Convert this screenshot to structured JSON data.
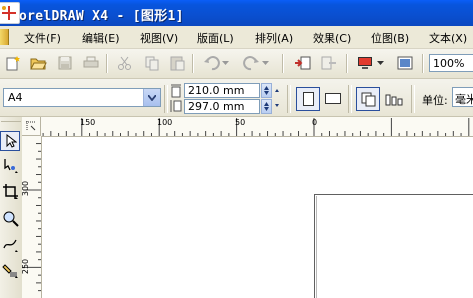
{
  "window": {
    "title": "orelDRAW X4 - [图形1]"
  },
  "menu": {
    "items": [
      "文件(F)",
      "编辑(E)",
      "视图(V)",
      "版面(L)",
      "排列(A)",
      "效果(C)",
      "位图(B)",
      "文本(X)"
    ]
  },
  "toolbar": {
    "zoom_value": "100%",
    "icons": [
      "new-document-icon",
      "open-folder-icon",
      "save-icon",
      "print-icon",
      "cut-icon",
      "copy-icon",
      "paste-icon",
      "undo-icon",
      "redo-icon",
      "import-icon",
      "export-icon",
      "application-launcher-icon",
      "welcome-screen-icon"
    ]
  },
  "property_bar": {
    "paper_size": "A4",
    "width": "210.0 mm",
    "height": "297.0 mm",
    "units_label": "单位:",
    "units_value": "毫米"
  },
  "rulers": {
    "horizontal_labels": [
      "150",
      "100",
      "50",
      "0"
    ],
    "vertical_labels": [
      "300",
      "250"
    ],
    "units": "毫米"
  },
  "toolbox": {
    "tools": [
      "pick-tool-icon",
      "shape-tool-icon",
      "crop-tool-icon",
      "zoom-tool-icon",
      "freehand-tool-icon",
      "smart-fill-tool-icon"
    ]
  },
  "colors": {
    "titlebar": "#0a5ef8",
    "chrome": "#ece9d8",
    "canvas": "#ffffff",
    "page_border": "#606060"
  }
}
